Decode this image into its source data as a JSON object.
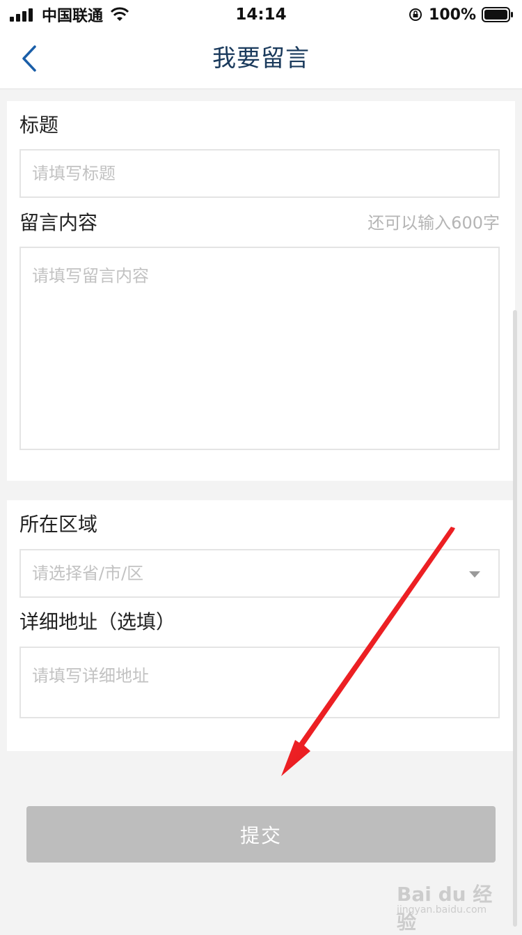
{
  "status_bar": {
    "carrier": "中国联通",
    "time": "14:14",
    "battery": "100%"
  },
  "nav": {
    "title": "我要留言"
  },
  "form": {
    "title_label": "标题",
    "title_placeholder": "请填写标题",
    "content_label": "留言内容",
    "content_counter": "还可以输入600字",
    "content_placeholder": "请填写留言内容",
    "region_label": "所在区域",
    "region_placeholder": "请选择省/市/区",
    "address_label": "详细地址（选填）",
    "address_placeholder": "请填写详细地址"
  },
  "submit_label": "提交",
  "watermark": {
    "logo": "Bai du 经验",
    "url": "jingyan.baidu.com"
  },
  "colors": {
    "title": "#1a3a5c",
    "submit_bg": "#bdbdbd",
    "arrow": "#e8141b"
  }
}
